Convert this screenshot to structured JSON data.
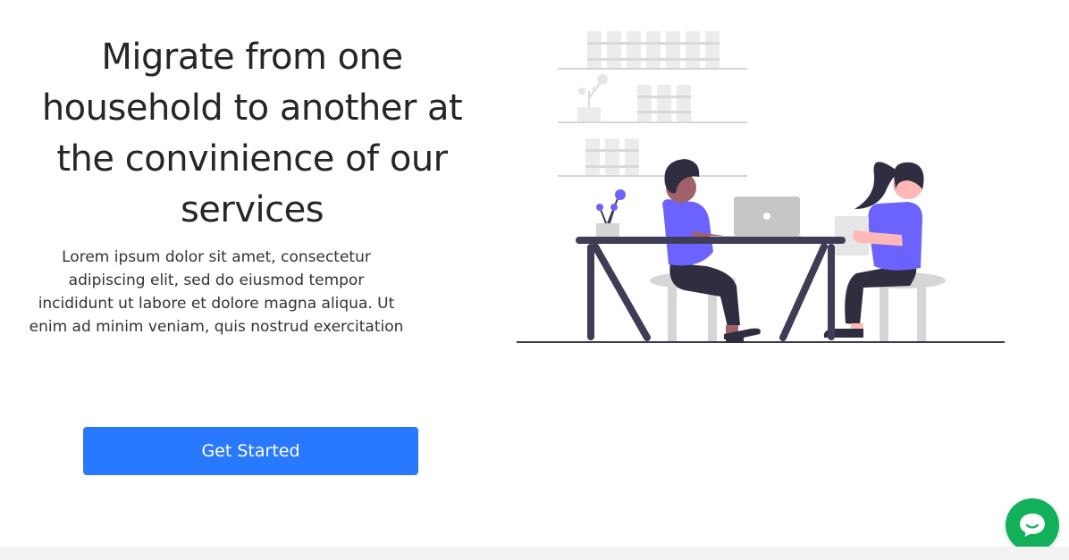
{
  "hero": {
    "title": "Migrate from one household to another at the convinience of our services",
    "description": "Lorem ipsum dolor sit amet, consectetur adipiscing elit, sed do eiusmod tempor incididunt ut labore et dolore magna aliqua. Ut enim ad minim veniam, quis nostrud exercitation",
    "cta_label": "Get Started"
  },
  "colors": {
    "primary": "#2979ff",
    "chat": "#13b05b",
    "illustration_purple": "#6c63ff",
    "illustration_dark": "#3f3d56"
  },
  "icons": {
    "chat": "chat-bubble-icon"
  }
}
